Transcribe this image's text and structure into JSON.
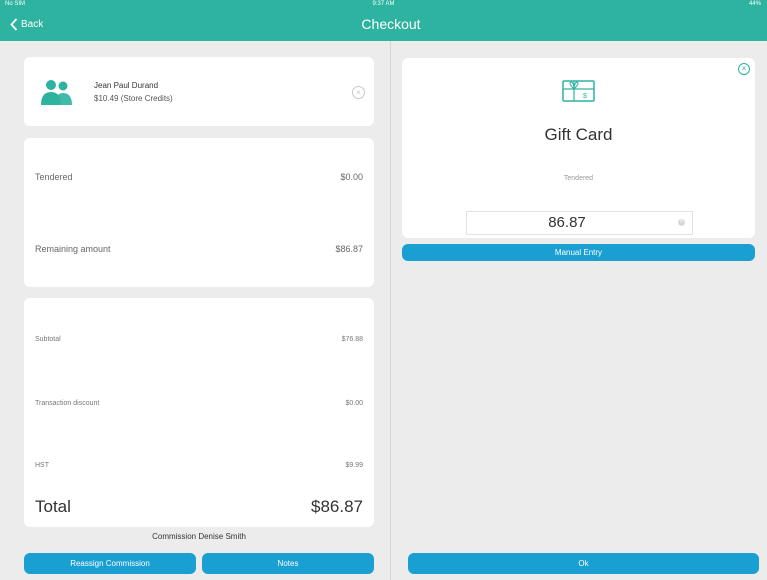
{
  "status_bar": {
    "carrier": "No SIM",
    "time": "9:37 AM",
    "battery": "44%"
  },
  "nav": {
    "back_label": "Back",
    "title": "Checkout"
  },
  "customer": {
    "name": "Jean Paul Durand",
    "credits": "$10.49  (Store Credits)"
  },
  "payment": {
    "tendered_label": "Tendered",
    "tendered_value": "$0.00",
    "remaining_label": "Remaining amount",
    "remaining_value": "$86.87"
  },
  "summary": {
    "subtotal_label": "Subtotal",
    "subtotal_value": "$76.88",
    "discount_label": "Transaction discount",
    "discount_value": "$0.00",
    "tax_label": "HST",
    "tax_value": "$9.99",
    "total_label": "Total",
    "total_value": "$86.87"
  },
  "commission_text": "Commission Denise Smith",
  "buttons": {
    "reassign": "Reassign Commission",
    "notes": "Notes",
    "manual_entry": "Manual Entry",
    "ok": "Ok"
  },
  "gift_card": {
    "title": "Gift Card",
    "subtitle": "Tendered",
    "amount": "86.87"
  },
  "colors": {
    "accent": "#2db3a0",
    "button": "#1a9fd3",
    "background": "#ececec"
  }
}
